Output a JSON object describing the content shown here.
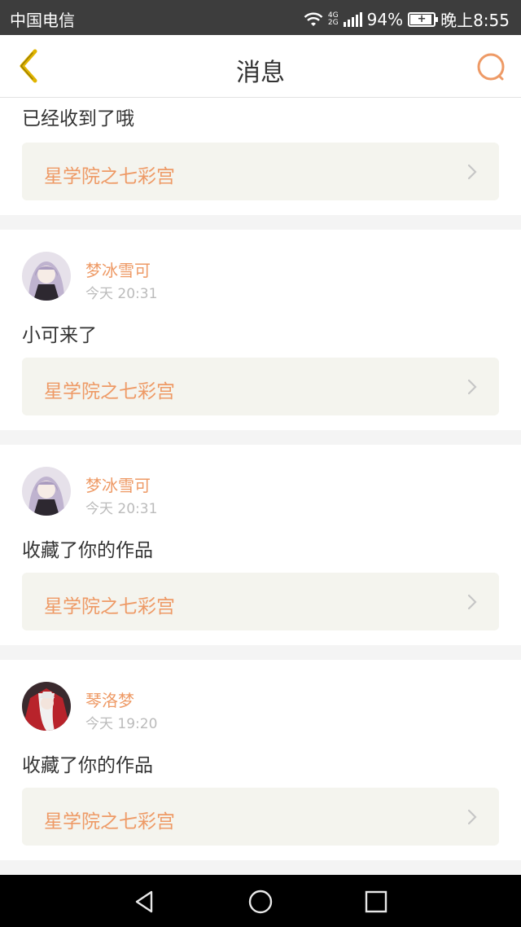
{
  "status_bar": {
    "carrier": "中国电信",
    "network_label_top": "4G",
    "network_label_bottom": "2G",
    "battery_percent": "94%",
    "battery_level": 0.94,
    "time": "晚上8:55"
  },
  "header": {
    "title": "消息",
    "back_icon": "chevron-left-icon",
    "search_icon": "search-icon"
  },
  "colors": {
    "accent": "#ee9a66",
    "back_icon": "#e0b400",
    "card_link_bg": "#f4f4ee",
    "page_bg": "#f4f4f4"
  },
  "messages": [
    {
      "text": "已经收到了哦",
      "work_title": "星学院之七彩宫"
    },
    {
      "user": "梦冰雪可",
      "time": "今天 20:31",
      "text": "小可来了",
      "work_title": "星学院之七彩宫"
    },
    {
      "user": "梦冰雪可",
      "time": "今天 20:31",
      "text": "收藏了你的作品",
      "work_title": "星学院之七彩宫"
    },
    {
      "user": "琴洛梦",
      "time": "今天 19:20",
      "text": "收藏了你的作品",
      "work_title": "星学院之七彩宫"
    }
  ],
  "system_nav": {
    "back": "triangle-back-icon",
    "home": "circle-home-icon",
    "recents": "square-recents-icon"
  }
}
